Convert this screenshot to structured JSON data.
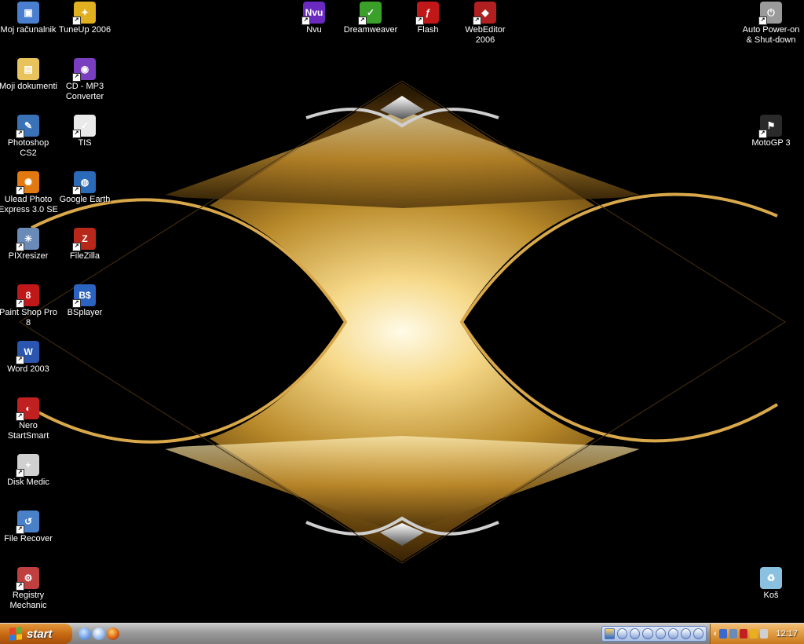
{
  "desktop_left": [
    {
      "label": "Moj računalnik",
      "icon": "computer-icon",
      "color": "#4a7fd0",
      "glyph": "▣",
      "shortcut": false
    },
    {
      "label": "TuneUp  2006",
      "icon": "tuneup-icon",
      "color": "#e0b020",
      "glyph": "✦",
      "shortcut": true
    },
    {
      "label": "Moji dokumenti",
      "icon": "documents-folder-icon",
      "color": "#e8c25a",
      "glyph": "▤",
      "shortcut": false
    },
    {
      "label": "CD - MP3\nConverter",
      "icon": "cd-mp3-icon",
      "color": "#7a3fc0",
      "glyph": "◉",
      "shortcut": true
    },
    {
      "label": "Photoshop CS2",
      "icon": "photoshop-icon",
      "color": "#3a72b8",
      "glyph": "✎",
      "shortcut": true
    },
    {
      "label": "TIS",
      "icon": "tis-icon",
      "color": "#eaeaea",
      "glyph": "✓",
      "shortcut": true
    },
    {
      "label": "Ulead Photo\nExpress 3.0 SE",
      "icon": "ulead-icon",
      "color": "#e07a10",
      "glyph": "✺",
      "shortcut": true
    },
    {
      "label": "Google Earth",
      "icon": "google-earth-icon",
      "color": "#2a6ab8",
      "glyph": "◍",
      "shortcut": true
    },
    {
      "label": "PIXresizer",
      "icon": "pixresizer-icon",
      "color": "#6a8ab8",
      "glyph": "✳",
      "shortcut": true
    },
    {
      "label": "FileZilla",
      "icon": "filezilla-icon",
      "color": "#b8281a",
      "glyph": "Z",
      "shortcut": true
    },
    {
      "label": "Paint Shop Pro\n8",
      "icon": "paintshop-icon",
      "color": "#c01818",
      "glyph": "8",
      "shortcut": true
    },
    {
      "label": "BSplayer",
      "icon": "bsplayer-icon",
      "color": "#2a64c0",
      "glyph": "B$",
      "shortcut": true
    },
    {
      "label": "Word 2003",
      "icon": "word-icon",
      "color": "#2a56b0",
      "glyph": "W",
      "shortcut": true
    },
    {
      "label": "Nero\nStartSmart",
      "icon": "nero-icon",
      "color": "#c02020",
      "glyph": "◐",
      "shortcut": true
    },
    {
      "label": "Disk Medic",
      "icon": "disk-medic-icon",
      "color": "#d0d0d0",
      "glyph": "+",
      "shortcut": true
    },
    {
      "label": "File Recover",
      "icon": "file-recover-icon",
      "color": "#4a80c8",
      "glyph": "↺",
      "shortcut": true
    },
    {
      "label": "Registry\nMechanic",
      "icon": "registry-mechanic-icon",
      "color": "#c04040",
      "glyph": "⚙",
      "shortcut": true
    }
  ],
  "desktop_top": [
    {
      "label": "Nvu",
      "icon": "nvu-icon",
      "color": "#6a2ac0",
      "glyph": "Nvu",
      "shortcut": true
    },
    {
      "label": "Dreamweaver",
      "icon": "dreamweaver-icon",
      "color": "#3aa02a",
      "glyph": "✓",
      "shortcut": true
    },
    {
      "label": "Flash",
      "icon": "flash-icon",
      "color": "#c01818",
      "glyph": "ƒ",
      "shortcut": true
    },
    {
      "label": "WebEditor\n2006",
      "icon": "webeditor-icon",
      "color": "#b02020",
      "glyph": "◆",
      "shortcut": true
    }
  ],
  "desktop_right": [
    {
      "label": "Auto Power-on\n& Shut-down",
      "icon": "auto-power-icon",
      "color": "#9a9a9a",
      "glyph": "⏻",
      "shortcut": true
    },
    {
      "label": "MotoGP 3",
      "icon": "motogp-icon",
      "color": "#2a2a2a",
      "glyph": "⚑",
      "shortcut": true
    },
    {
      "label": "Koš",
      "icon": "recycle-bin-icon",
      "color": "#8ac0e0",
      "glyph": "♻",
      "shortcut": false
    }
  ],
  "taskbar": {
    "start_label": "start",
    "quick_launch": [
      "show-desktop-icon",
      "media-player-icon",
      "firefox-icon"
    ],
    "clock": "12:17"
  }
}
